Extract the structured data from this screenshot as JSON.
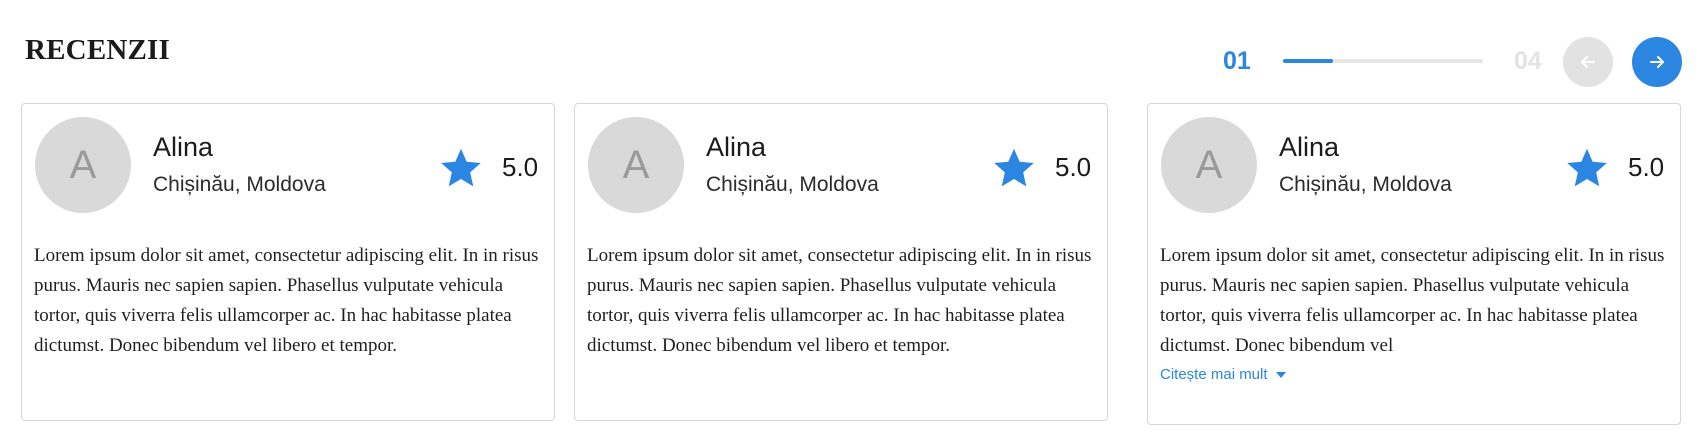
{
  "section": {
    "title": "RECENZII"
  },
  "pager": {
    "current": "01",
    "total": "04",
    "progress_fraction": 0.25,
    "prev_icon": "arrow-left-icon",
    "next_icon": "arrow-right-icon",
    "accent_color": "#2a86e0",
    "disabled_color": "#e2e2e2"
  },
  "reviews": [
    {
      "avatar_letter": "A",
      "name": "Alina",
      "location": "Chișinău, Moldova",
      "rating": "5.0",
      "star_icon": "star-icon",
      "text": "Lorem ipsum dolor sit amet, consectetur adipiscing elit. In in risus purus. Mauris nec sapien sapien. Phasellus vulputate vehicula tortor, quis viverra felis ullamcorper ac. In hac habitasse platea dictumst. Donec bibendum vel libero et tempor."
    },
    {
      "avatar_letter": "A",
      "name": "Alina",
      "location": "Chișinău, Moldova",
      "rating": "5.0",
      "star_icon": "star-icon",
      "text": "Lorem ipsum dolor sit amet, consectetur adipiscing elit. In in risus purus. Mauris nec sapien sapien. Phasellus vulputate vehicula tortor, quis viverra felis ullamcorper ac. In hac habitasse platea dictumst. Donec bibendum vel libero et tempor."
    },
    {
      "avatar_letter": "A",
      "name": "Alina",
      "location": "Chișinău, Moldova",
      "rating": "5.0",
      "star_icon": "star-icon",
      "text": "Lorem ipsum dolor sit amet, consectetur adipiscing elit. In in risus purus. Mauris nec sapien sapien. Phasellus vulputate vehicula tortor, quis viverra felis ullamcorper ac. In hac habitasse platea dictumst. Donec bibendum vel",
      "read_more": "Citește mai mult"
    }
  ]
}
